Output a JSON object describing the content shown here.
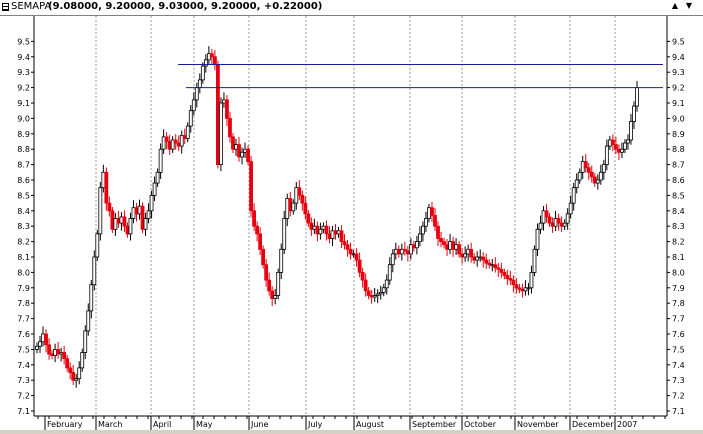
{
  "window": {
    "symbol": "SEMAPA",
    "quote": "(9.08000, 9.20000, 9.03000, 9.20000, +0.22000)",
    "scroll_up_glyph": "▲",
    "scroll_down_glyph": "▼"
  },
  "colors": {
    "up": "#000000",
    "down": "#e8000e",
    "grid": "#9a9a9a",
    "trendline": "#1c1c99",
    "background": "#ffffff"
  },
  "chart_data": {
    "type": "candlestick",
    "ylim": [
      7.1,
      9.6
    ],
    "y_ticks": [
      "9.5",
      "9.4",
      "9.3",
      "9.2",
      "9.1",
      "9.0",
      "8.9",
      "8.8",
      "8.7",
      "8.6",
      "8.5",
      "8.4",
      "8.3",
      "8.2",
      "8.1",
      "8.0",
      "7.9",
      "7.8",
      "7.7",
      "7.6",
      "7.5",
      "7.4",
      "7.3",
      "7.2",
      "7.1"
    ],
    "x_labels": [
      "February",
      "March",
      "April",
      "May",
      "June",
      "July",
      "August",
      "September",
      "October",
      "November",
      "December",
      "2007"
    ],
    "grid": true,
    "horizontal_lines": [
      9.35,
      9.2
    ],
    "closes": [
      7.52,
      7.55,
      7.6,
      7.53,
      7.47,
      7.46,
      7.5,
      7.47,
      7.48,
      7.44,
      7.38,
      7.35,
      7.3,
      7.31,
      7.38,
      7.48,
      7.62,
      7.75,
      7.92,
      8.1,
      8.25,
      8.55,
      8.65,
      8.45,
      8.4,
      8.28,
      8.35,
      8.32,
      8.36,
      8.3,
      8.25,
      8.35,
      8.42,
      8.38,
      8.43,
      8.28,
      8.35,
      8.4,
      8.5,
      8.58,
      8.65,
      8.8,
      8.88,
      8.85,
      8.8,
      8.86,
      8.84,
      8.82,
      8.89,
      8.87,
      8.95,
      9.05,
      9.12,
      9.2,
      9.25,
      9.34,
      9.38,
      9.42,
      9.4,
      9.35,
      8.7,
      9.1,
      9.12,
      9.0,
      8.88,
      8.8,
      8.83,
      8.75,
      8.78,
      8.8,
      8.72,
      8.4,
      8.3,
      8.25,
      8.15,
      8.05,
      7.95,
      7.88,
      7.83,
      7.85,
      8.0,
      8.15,
      8.35,
      8.48,
      8.4,
      8.45,
      8.55,
      8.5,
      8.45,
      8.38,
      8.32,
      8.28,
      8.3,
      8.25,
      8.28,
      8.3,
      8.25,
      8.22,
      8.27,
      8.25,
      8.27,
      8.2,
      8.18,
      8.15,
      8.12,
      8.12,
      8.08,
      8.0,
      7.95,
      7.88,
      7.85,
      7.84,
      7.85,
      7.86,
      7.87,
      7.9,
      7.95,
      8.05,
      8.12,
      8.15,
      8.12,
      8.15,
      8.14,
      8.12,
      8.18,
      8.16,
      8.2,
      8.25,
      8.3,
      8.35,
      8.42,
      8.37,
      8.3,
      8.22,
      8.2,
      8.18,
      8.15,
      8.2,
      8.15,
      8.18,
      8.12,
      8.1,
      8.12,
      8.15,
      8.1,
      8.08,
      8.1,
      8.1,
      8.08,
      8.06,
      8.05,
      8.05,
      8.03,
      8.02,
      8.0,
      7.98,
      7.96,
      7.95,
      7.92,
      7.9,
      7.89,
      7.88,
      7.9,
      7.9,
      8.0,
      8.15,
      8.28,
      8.32,
      8.4,
      8.36,
      8.32,
      8.3,
      8.35,
      8.32,
      8.3,
      8.32,
      8.38,
      8.45,
      8.55,
      8.6,
      8.65,
      8.72,
      8.68,
      8.65,
      8.62,
      8.58,
      8.6,
      8.65,
      8.7,
      8.82,
      8.86,
      8.83,
      8.8,
      8.78,
      8.8,
      8.84,
      8.86,
      8.98,
      9.08,
      9.2
    ]
  }
}
